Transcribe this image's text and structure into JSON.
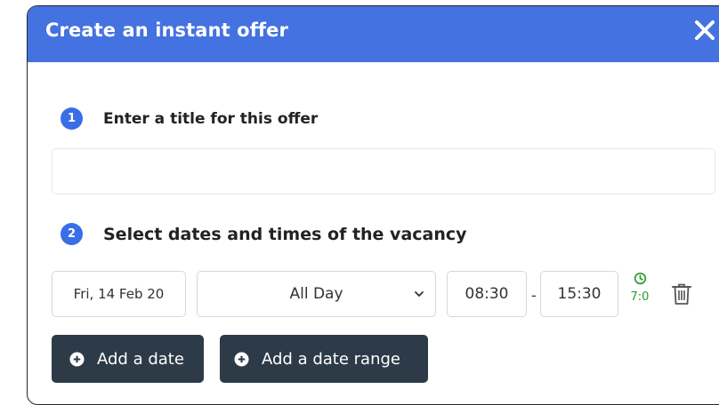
{
  "dialog": {
    "title": "Create an instant offer",
    "close_icon": "close-icon"
  },
  "steps": [
    {
      "number": "1",
      "label": "Enter a title for this offer"
    },
    {
      "number": "2",
      "label": "Select dates and times of the vacancy"
    }
  ],
  "title_input": {
    "value": "",
    "placeholder": ""
  },
  "vacancy_row": {
    "date": "Fri, 14 Feb 20",
    "period": "All Day",
    "start_time": "08:30",
    "separator": "-",
    "end_time": "15:30",
    "duration": "7:0",
    "duration_icon": "clock-icon",
    "delete_icon": "trash-icon"
  },
  "actions": {
    "add_date": "Add a date",
    "add_date_range": "Add a date range",
    "add_icon": "plus-circle-icon"
  },
  "colors": {
    "header": "#4472e0",
    "badge": "#3a6ee6",
    "button": "#2d3a48",
    "duration": "#2e9a2e"
  }
}
